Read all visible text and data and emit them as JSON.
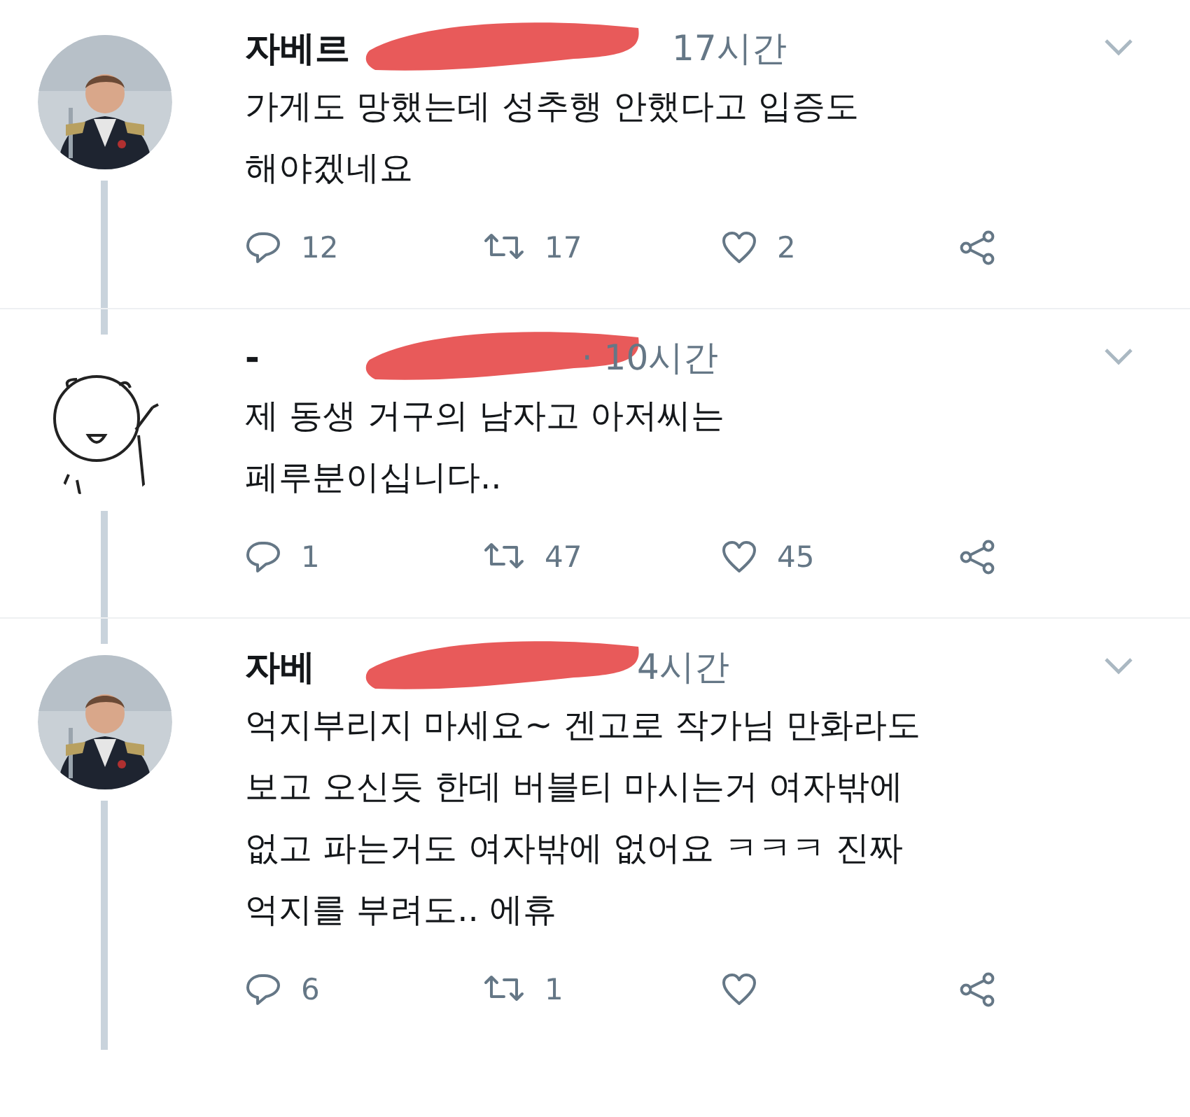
{
  "tweets": [
    {
      "name": "자베르",
      "redacted": true,
      "time": "17시간",
      "text": "가게도 망했는데 성추행 안했다고 입증도\n해야겠네요",
      "replies": "12",
      "retweets": "17",
      "likes": "2"
    },
    {
      "kind": "doodle",
      "name": "-",
      "redacted": true,
      "time": "· 10시간",
      "text": "제 동생 거구의 남자고 아저씨는\n페루분이십니다..",
      "replies": "1",
      "retweets": "47",
      "likes": "45"
    },
    {
      "name": "자베",
      "redacted": true,
      "time": "4시간",
      "text": "억지부리지 마세요~ 겐고로 작가님 만화라도\n보고 오신듯 한데 버블티 마시는거 여자밖에\n없고 파는거도 여자밖에 없어요 ㅋㅋㅋ 진짜\n억지를 부려도.. 에휴",
      "replies": "6",
      "retweets": "1"
    }
  ]
}
